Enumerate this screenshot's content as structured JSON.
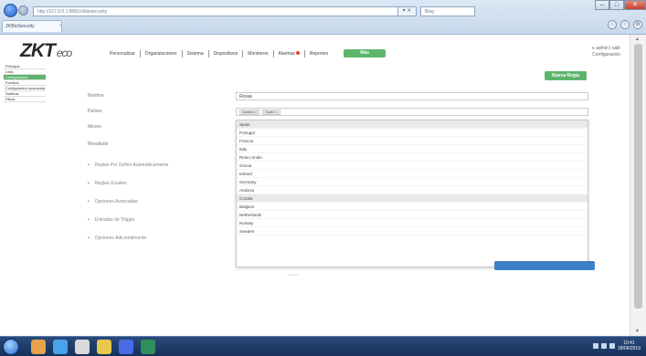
{
  "browser": {
    "address": "http://127.0.0.1:8081/zkbiosecurity",
    "address_tools": "▾ ✕",
    "search_placeholder": "Bing",
    "tab_title": "ZKBioSecurity",
    "tab_close": "×",
    "window_buttons": [
      "–",
      "□",
      "✕"
    ],
    "tool_icons": [
      "⌂",
      "☆",
      "⚙"
    ]
  },
  "app": {
    "logo": "ZKT",
    "logo_suffix": "eco",
    "menu": [
      {
        "label": "Personalizar"
      },
      {
        "label": "Organizaciones"
      },
      {
        "label": "Sistema"
      },
      {
        "label": "Dispositivos"
      },
      {
        "label": "Monitoreo"
      },
      {
        "label": "Alarmas",
        "badge": true
      },
      {
        "label": "Reportes"
      }
    ],
    "menu_active": "Más",
    "user": {
      "line1": "admin | salir",
      "line2": "Configuración"
    }
  },
  "sidebar": {
    "items": [
      {
        "label": "Principal",
        "active": false
      },
      {
        "label": "Lista",
        "active": false
      },
      {
        "label": "Configuración",
        "active": true
      },
      {
        "label": "Eventos",
        "active": false
      },
      {
        "label": "Configuración avanzada",
        "active": false
      },
      {
        "label": "Notificar",
        "active": false
      },
      {
        "label": "Filtrar",
        "active": false
      }
    ]
  },
  "form": {
    "new_button": "Nueva Regla",
    "labels": {
      "nombre": "Nombre",
      "paises": "Países",
      "mes": "Meses",
      "resultado": "Resultado"
    },
    "nombre_value": "Rosas",
    "chips": [
      "Austria ×",
      "Spain ×"
    ],
    "options": [
      {
        "label": "Spain",
        "highlight": true
      },
      {
        "label": "Portugal",
        "highlight": false
      },
      {
        "label": "Francia",
        "highlight": false
      },
      {
        "label": "Italy",
        "highlight": false
      },
      {
        "label": "Reino Unido",
        "highlight": false
      },
      {
        "label": "Grecia",
        "highlight": false
      },
      {
        "label": "Ireland",
        "highlight": false
      },
      {
        "label": "Germany",
        "highlight": false
      },
      {
        "label": "Andorra",
        "highlight": false
      },
      {
        "label": "Croatia",
        "highlight": true
      },
      {
        "label": "Belgium",
        "highlight": false
      },
      {
        "label": "Netherlands",
        "highlight": false
      },
      {
        "label": "Norway",
        "highlight": false
      },
      {
        "label": "Sweden",
        "highlight": false
      }
    ],
    "bullets": [
      "Reglas Por Definir Automáticamente",
      "Reglas Usuales",
      "Opciones Avanzadas",
      "Entradas de Trigger",
      "Opciones Adicionalmente"
    ],
    "page_dots": "• • • • •"
  },
  "scrollbar": {
    "up": "▲",
    "down": "▼"
  },
  "taskbar": {
    "icons": [
      {
        "color": "#e8a34a"
      },
      {
        "color": "#4aa3e8"
      },
      {
        "color": "#d9d9d9"
      },
      {
        "color": "#e8c84a"
      },
      {
        "color": "#4a6ae8"
      },
      {
        "color": "#2f8f5a"
      }
    ],
    "time": "10:41",
    "date": "18/06/2019"
  }
}
